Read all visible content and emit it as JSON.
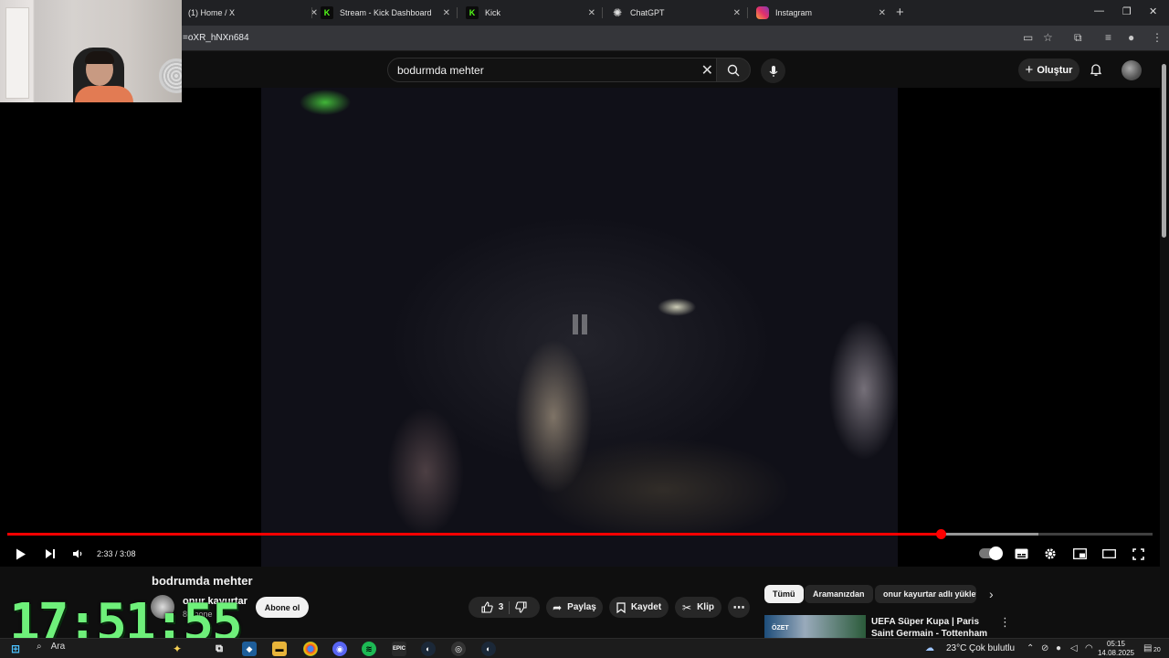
{
  "tabs": [
    {
      "title": "(1) Home / X",
      "close": "✕"
    },
    {
      "title": "Stream - Kick Dashboard",
      "close": "✕"
    },
    {
      "title": "Kick",
      "close": "✕"
    },
    {
      "title": "ChatGPT",
      "close": "✕"
    },
    {
      "title": "Instagram",
      "close": "✕"
    }
  ],
  "new_tab": "+",
  "window_controls": {
    "minimize": "—",
    "restore": "❐",
    "close": "✕"
  },
  "address": {
    "url": "=oXR_hNXn684"
  },
  "header": {
    "search_value": "bodurmda mehter",
    "create_label": "Oluştur"
  },
  "player": {
    "time_current": "2:33",
    "time_total": "3:08",
    "time_text": "2:33 / 3:08",
    "played_fraction": 0.815,
    "buffered_fraction": 0.9
  },
  "video": {
    "title": "bodrumda mehter",
    "channel_name": "onur kayurtar",
    "subscribers": "8 abone",
    "subscribe_label": "Abone ol",
    "like_count": "3",
    "share_label": "Paylaş",
    "save_label": "Kaydet",
    "clip_label": "Klip"
  },
  "related": {
    "chips": [
      "Tümü",
      "Aramanızdan",
      "onur kayurtar adlı yükleyi"
    ],
    "item": {
      "badge": "ÖZET",
      "title": "UEFA Süper Kupa | Paris Saint Germain - Tottenham (Özet)"
    }
  },
  "stream_clock": "17:51:55",
  "taskbar": {
    "search_label": "Ara",
    "weather_temp": "23°C",
    "weather_text": "Çok bulutlu",
    "time": "05:15",
    "date": "14.08.2025",
    "notif_count": "20"
  },
  "colors": {
    "accent_red": "#ff0000",
    "clock_green": "#6ef07a",
    "kick_green": "#53fc18"
  }
}
